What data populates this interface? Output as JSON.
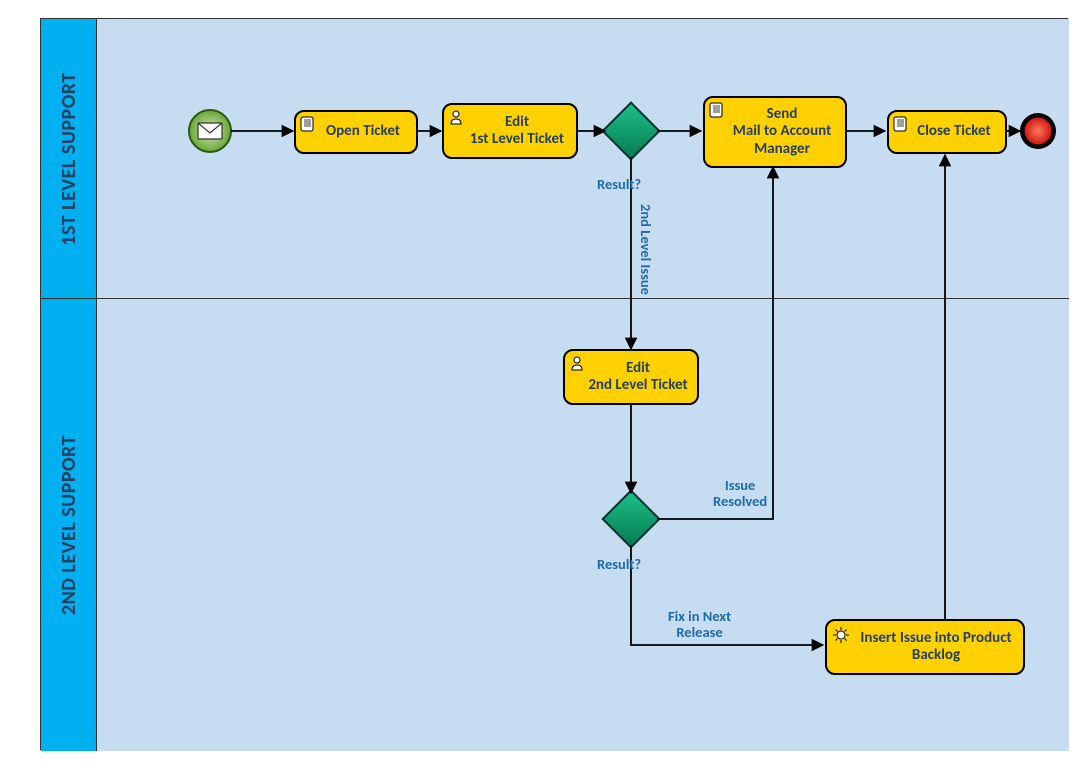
{
  "lanes": {
    "top": "1ST LEVEL SUPPORT",
    "bottom": "2ND LEVEL SUPPORT"
  },
  "tasks": {
    "open_ticket": "Open Ticket",
    "edit_1st": "Edit\n1st Level Ticket",
    "send_mail": "Send\nMail to Account Manager",
    "close_ticket": "Close Ticket",
    "edit_2nd": "Edit\n2nd Level Ticket",
    "insert_backlog": "Insert Issue into Product Backlog"
  },
  "labels": {
    "result1": "Result?",
    "second_level_issue": "2nd Level Issue",
    "result2": "Result?",
    "issue_resolved": "Issue\nResolved",
    "fix_next": "Fix in Next\nRelease"
  },
  "colors": {
    "task_fill": "#ffd100",
    "task_stroke": "#000000",
    "lane_header": "#00b0f0",
    "lane_body": "#c6dcf0",
    "gateway_fill": "#0aa060",
    "start_fill": "#66b23c",
    "end_fill": "#e62020",
    "label": "#1f6ba5"
  }
}
